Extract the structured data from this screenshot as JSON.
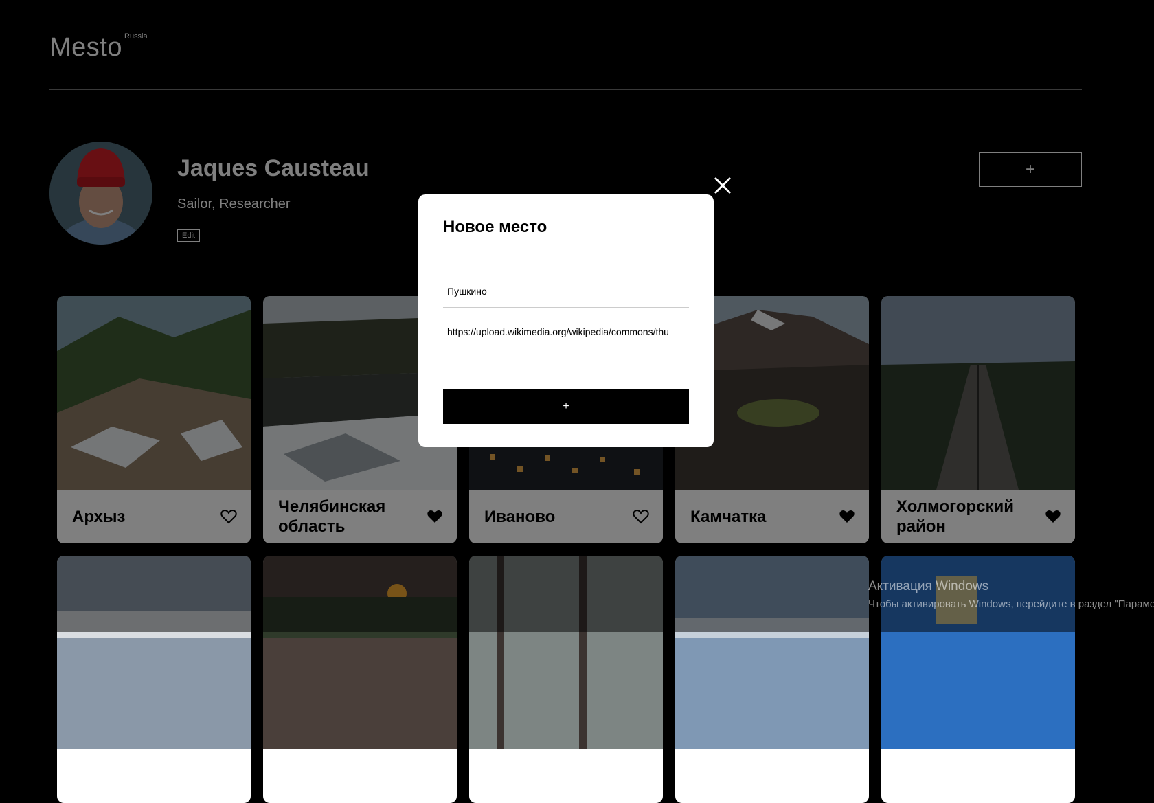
{
  "header": {
    "logo": "Mesto",
    "logo_sup": "Russia"
  },
  "profile": {
    "name": "Jaques Causteau",
    "about": "Sailor, Researcher",
    "edit_label": "Edit",
    "add_label": "+"
  },
  "cards": [
    {
      "title": "Архыз",
      "liked": false
    },
    {
      "title": "Челябинская область",
      "liked": true
    },
    {
      "title": "Иваново",
      "liked": false
    },
    {
      "title": "Камчатка",
      "liked": true
    },
    {
      "title": "Холмогорский район",
      "liked": true
    }
  ],
  "popup": {
    "title": "Новое место",
    "name_value": "Пушкино",
    "link_value": "https://upload.wikimedia.org/wikipedia/commons/thu",
    "submit_label": "+",
    "close_icon": "close-icon"
  },
  "watermark": {
    "title": "Активация Windows",
    "text": "Чтобы активировать Windows, перейдите в раздел \"Параме"
  },
  "colors": {
    "background": "#000000",
    "popup": "#ffffff",
    "accent": "#000000"
  }
}
